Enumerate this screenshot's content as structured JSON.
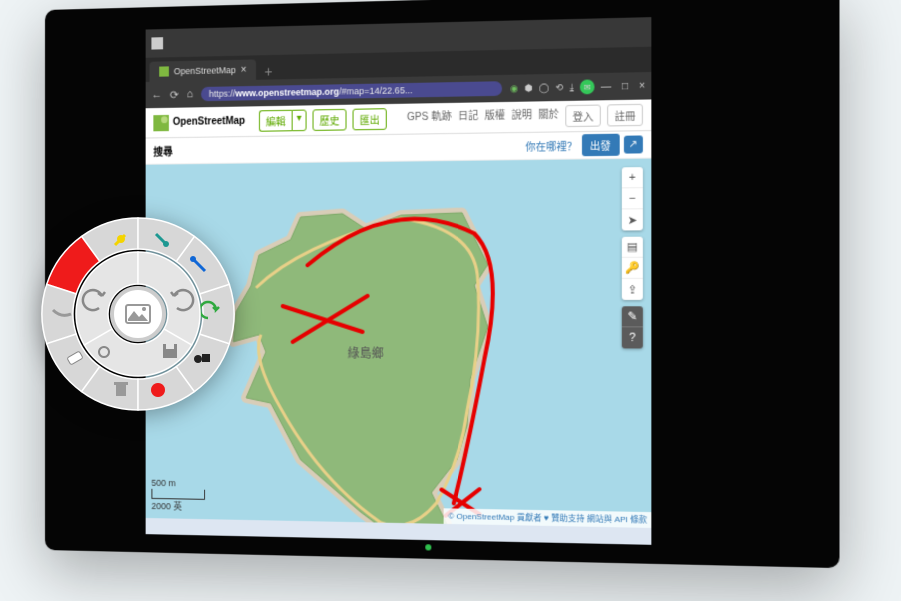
{
  "browser": {
    "tab_title": "OpenStreetMap",
    "url_prefix": "https://",
    "url_host": "www.openstreetmap.org",
    "url_path": "/#map=14/22.65...",
    "win_min": "—",
    "win_max": "□",
    "win_close": "×",
    "tab_close": "×",
    "tab_plus": "+",
    "nav_back": "←",
    "nav_reload": "⟳",
    "nav_home": "⌂"
  },
  "osm": {
    "logo_text": "OpenStreetMap",
    "edit": "編輯",
    "edit_caret": "▾",
    "history": "歷史",
    "export": "匯出",
    "right_links": [
      "GPS 軌跡",
      "日記",
      "版權",
      "說明",
      "關於"
    ],
    "login": "登入",
    "signup": "註冊",
    "search_label": "搜尋",
    "where_link": "你在哪裡？",
    "go_btn": "出發",
    "dir_btn": "↗"
  },
  "map": {
    "island_label": "綠島鄉",
    "zoom_in": "+",
    "zoom_out": "−",
    "locate": "➤",
    "layers": "▤",
    "key": "🔑",
    "share": "⇪",
    "note": "✎",
    "query": "?",
    "scale_top": "500 m",
    "scale_bottom": "2000 英",
    "attribution": "© OpenStreetMap 貢獻者 ♥ 贊助支持  網站與 API 條款"
  },
  "radial": {
    "pen_yellow": "pen",
    "color_picker": "color",
    "brush": "brush",
    "undo": "undo",
    "redo": "redo",
    "eraser": "eraser",
    "save": "save",
    "shapes": "shapes",
    "trash": "trash",
    "record": "record",
    "center": "screenshot"
  }
}
